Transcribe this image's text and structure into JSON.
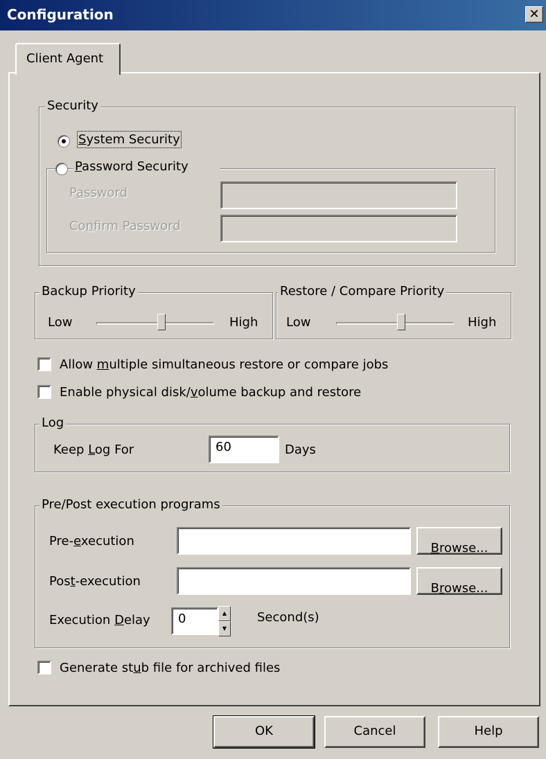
{
  "window": {
    "title": "Configuration",
    "close": "✕"
  },
  "tabs": [
    {
      "label": "Client Agent"
    }
  ],
  "security": {
    "legend": "Security",
    "system_label_pre": "",
    "system_label_u": "S",
    "system_label_post": "ystem Security",
    "password_label_u": "P",
    "password_label_post": "assword Security",
    "selected": "system",
    "password_field_label_pre": "P",
    "password_field_label_u": "a",
    "password_field_label_post": "ssword",
    "confirm_label_pre": "Co",
    "confirm_label_u": "n",
    "confirm_label_post": "firm Password",
    "password_value": "",
    "confirm_value": ""
  },
  "backup_priority": {
    "legend": "Backup Priority",
    "low": "Low",
    "high": "High",
    "level": 0.55
  },
  "restore_priority": {
    "legend": "Restore / Compare Priority",
    "low": "Low",
    "high": "High",
    "level": 0.55
  },
  "options": {
    "multi_pre": "Allow ",
    "multi_u": "m",
    "multi_post": "ultiple simultaneous restore or compare jobs",
    "multi_checked": false,
    "physical_pre": "Enable physical disk/",
    "physical_u": "v",
    "physical_post": "olume backup and restore",
    "physical_checked": false
  },
  "log": {
    "legend": "Log",
    "keep_pre": "Keep ",
    "keep_u": "L",
    "keep_post": "og For",
    "days_value": "60",
    "days_unit": "Days"
  },
  "prepost": {
    "legend": "Pre/Post  execution programs",
    "pre_label_pre": "Pre-",
    "pre_label_u": "e",
    "pre_label_post": "xecution",
    "post_label_pre": "Pos",
    "post_label_u": "t",
    "post_label_post": "-execution",
    "browse_u": "B",
    "browse_post": "rowse...",
    "browse2_pre": "B",
    "browse2_u": "r",
    "browse2_post": "owse...",
    "pre_value": "",
    "post_value": "",
    "delay_pre": "Execution ",
    "delay_u": "D",
    "delay_post": "elay",
    "delay_value": "0",
    "delay_unit": "Second(s)"
  },
  "stub": {
    "pre": "Generate st",
    "u": "u",
    "post": "b file for archived files",
    "checked": false
  },
  "buttons": {
    "ok": "OK",
    "cancel": "Cancel",
    "help": "Help"
  }
}
